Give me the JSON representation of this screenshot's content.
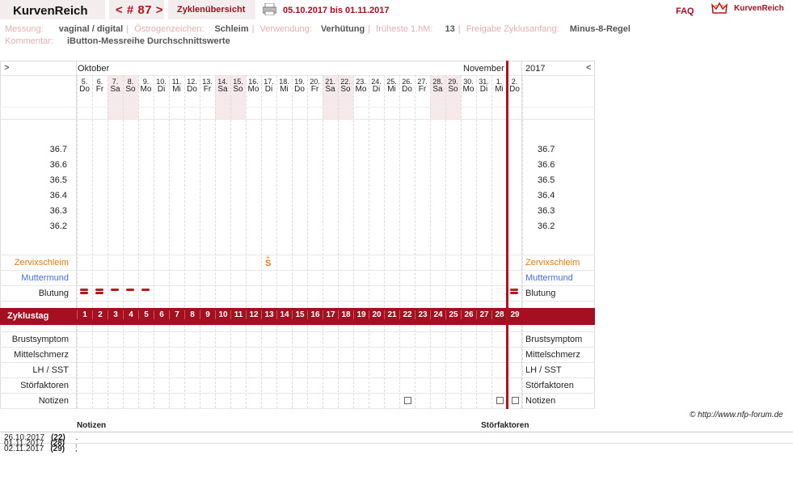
{
  "header": {
    "app_name": "KurvenReich",
    "cycle_nav": "< # 87 >",
    "overview_label": "Zyklenübersicht",
    "date_range": "05.10.2017 bis 01.11.2017",
    "faq_label": "FAQ",
    "brand_label": "KurvenReich"
  },
  "meta": {
    "row1": [
      {
        "key": "Messung:",
        "value": "vaginal / digital"
      },
      {
        "key": "Östrogenzeichen:",
        "value": "Schleim"
      },
      {
        "key": "Verwendung:",
        "value": "Verhütung"
      },
      {
        "key": "früheste 1.hM:",
        "value": "13"
      },
      {
        "key": "Freigabe Zyklusanfang:",
        "value": "Minus-8-Regel"
      }
    ],
    "row2": [
      {
        "key": "Kommentar:",
        "value": "iButton-Messreihe Durchschnittswerte"
      }
    ]
  },
  "chart": {
    "nav_left": ">",
    "nav_right": "<",
    "month_1": "Oktober",
    "month_2": "November",
    "year": "2017",
    "days": [
      {
        "d": "5.",
        "w": "Do"
      },
      {
        "d": "6.",
        "w": "Fr"
      },
      {
        "d": "7.",
        "w": "Sa"
      },
      {
        "d": "8.",
        "w": "So"
      },
      {
        "d": "9.",
        "w": "Mo"
      },
      {
        "d": "10.",
        "w": "Di"
      },
      {
        "d": "11.",
        "w": "Mi"
      },
      {
        "d": "12.",
        "w": "Do"
      },
      {
        "d": "13.",
        "w": "Fr"
      },
      {
        "d": "14.",
        "w": "Sa"
      },
      {
        "d": "15.",
        "w": "So"
      },
      {
        "d": "16.",
        "w": "Mo"
      },
      {
        "d": "17.",
        "w": "Di"
      },
      {
        "d": "18.",
        "w": "Mi"
      },
      {
        "d": "19.",
        "w": "Do"
      },
      {
        "d": "20.",
        "w": "Fr"
      },
      {
        "d": "21.",
        "w": "Sa"
      },
      {
        "d": "22.",
        "w": "So"
      },
      {
        "d": "23.",
        "w": "Mo"
      },
      {
        "d": "24.",
        "w": "Di"
      },
      {
        "d": "25.",
        "w": "Mi"
      },
      {
        "d": "26.",
        "w": "Do"
      },
      {
        "d": "27.",
        "w": "Fr"
      },
      {
        "d": "28.",
        "w": "Sa"
      },
      {
        "d": "29.",
        "w": "So"
      },
      {
        "d": "30.",
        "w": "Mo"
      },
      {
        "d": "31.",
        "w": "Di"
      },
      {
        "d": "1.",
        "w": "Mi"
      },
      {
        "d": "2.",
        "w": "Do"
      }
    ],
    "temps": [
      "36.7",
      "36.6",
      "36.5",
      "36.4",
      "36.3",
      "36.2"
    ],
    "row_labels": {
      "zervix": "Zervixschleim",
      "muttermund": "Muttermund",
      "blutung": "Blutung",
      "zyklustag": "Zyklustag",
      "brust": "Brustsymptom",
      "mittel": "Mittelschmerz",
      "lh": "LH / SST",
      "stoer": "Störfaktoren",
      "notizen": "Notizen"
    },
    "cycle_days": [
      "1",
      "2",
      "3",
      "4",
      "5",
      "6",
      "7",
      "8",
      "9",
      "10",
      "11",
      "12",
      "13",
      "14",
      "15",
      "16",
      "17",
      "18",
      "19",
      "20",
      "21",
      "22",
      "23",
      "24",
      "25",
      "26",
      "27",
      "28",
      "29"
    ],
    "zervix_mark": "S",
    "zervix_mark_top": "+",
    "colors": {
      "accent": "#a50f22",
      "zervix": "#e07a10",
      "muttermund": "#4a6cd4",
      "weekend": "#f5e9ec"
    }
  },
  "footer": {
    "copyright": "© http://www.nfp-forum.de",
    "col_notes": "Notizen",
    "col_stoer": "Störfaktoren",
    "entries": [
      {
        "date": "26.10.2017",
        "day": "(22)",
        "text": "."
      },
      {
        "date": "01.11.2017",
        "day": "(28)",
        "text": "."
      },
      {
        "date": "02.11.2017",
        "day": "(29)",
        "text": ";"
      }
    ]
  }
}
